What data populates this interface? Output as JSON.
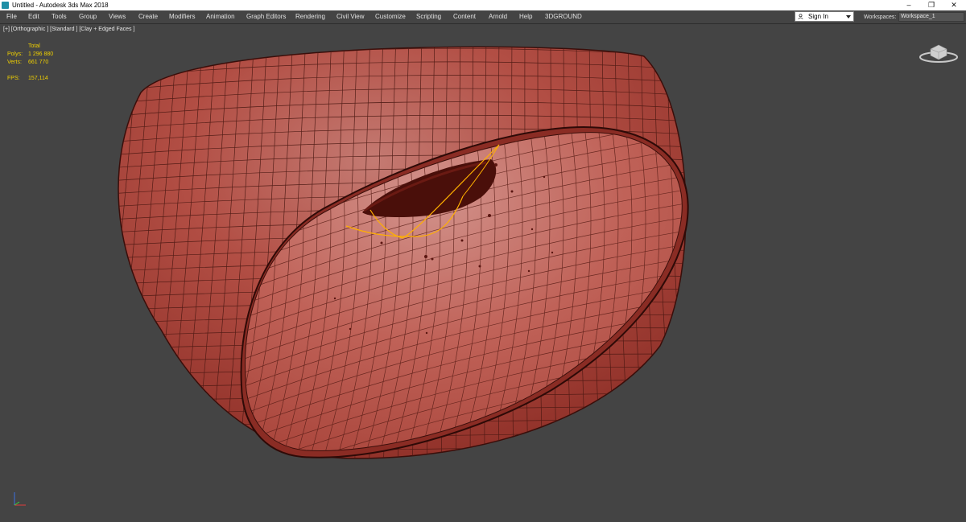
{
  "window": {
    "title": "Untitled - Autodesk 3ds Max 2018",
    "controls": {
      "minimize": "–",
      "restore": "❐",
      "close": "✕"
    }
  },
  "menu": {
    "items": [
      "File",
      "Edit",
      "Tools",
      "Group",
      "Views",
      "Create",
      "Modifiers",
      "Animation",
      "Graph Editors",
      "Rendering",
      "Civil View",
      "Customize",
      "Scripting",
      "Content",
      "Arnold",
      "Help",
      "3DGROUND"
    ],
    "sign_in": "Sign In",
    "workspaces_label": "Workspaces:",
    "workspace_value": "Workspace_1"
  },
  "viewport": {
    "label": "[+] [Orthographic ] [Standard ] [Clay + Edged Faces ]",
    "stats": {
      "total_label": "Total",
      "polys_label": "Polys:",
      "polys_value": "1 296 880",
      "verts_label": "Verts:",
      "verts_value": "661 770",
      "fps_label": "FPS:",
      "fps_value": "157,114"
    }
  },
  "colors": {
    "viewport_bg": "#444444",
    "clay_red": "#b24a40",
    "stats_yellow": "#f0d000",
    "selection_edge": "#ffb000"
  },
  "icons": {
    "app": "3ds-max-icon",
    "user": "user-icon",
    "viewcube": "viewcube-icon",
    "axis": "axis-tripod-icon"
  }
}
